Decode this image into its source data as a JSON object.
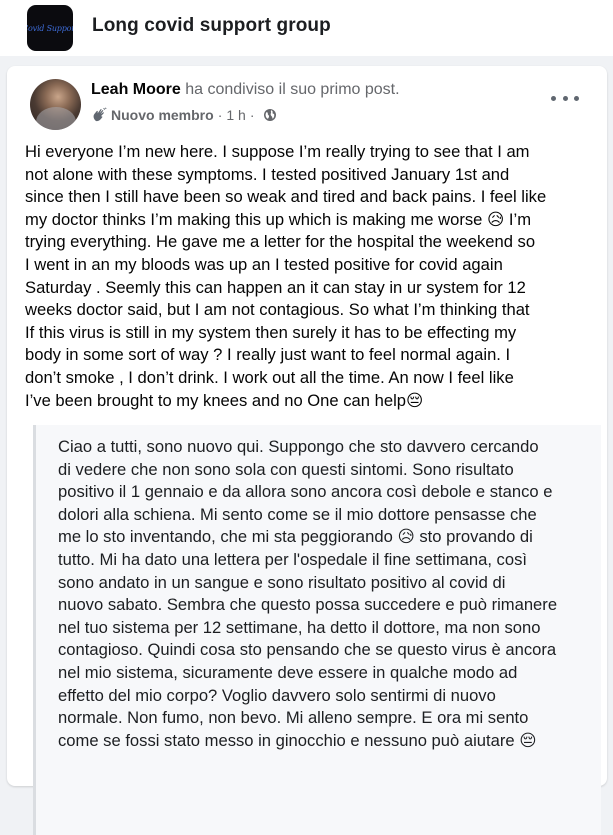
{
  "group": {
    "logo_text": "Covid Support",
    "name": "Long covid support group"
  },
  "post": {
    "author": "Leah Moore",
    "action": " ha condiviso il suo primo post.",
    "badge": "Nuovo membro",
    "separator": "·",
    "time": "1 h",
    "text": "Hi everyone I’m new here. I suppose I’m really trying to see that I am\nnot alone with these symptoms. I tested positived January 1st and\nsince then I still have been so weak and tired and back pains. I feel like\nmy doctor thinks I’m making this up which is making me worse 😥 I’m\ntrying everything. He gave me a letter for the hospital the weekend so\nI went in an my bloods was up an I tested positive for covid again\nSaturday . Seemly this can happen an it can stay in ur system for 12\nweeks doctor said, but I am not contagious. So what I’m thinking that\nIf this virus is still in my system then surely it has to be effecting my\nbody in some sort of way ? I really just want to feel normal again. I\ndon’t smoke , I don’t drink. I work out all the time. An now I feel like\nI’ve been brought to my knees and no One can help😔",
    "translation": "Ciao a tutti, sono nuovo qui. Suppongo che sto davvero cercando\ndi vedere che non sono sola con questi sintomi. Sono risultato\npositivo il 1 gennaio e da allora sono ancora così debole e stanco e\ndolori alla schiena. Mi sento come se il mio dottore pensasse che\nme lo sto inventando, che mi sta peggiorando 😥 sto provando di\ntutto. Mi ha dato una lettera per l'ospedale il fine settimana, così\nsono andato in un sangue e sono risultato positivo al covid di\nnuovo sabato. Sembra che questo possa succedere e può rimanere\nnel tuo sistema per 12 settimane, ha detto il dottore, ma non sono\ncontagioso. Quindi cosa sto pensando che se questo virus è ancora\nnel mio sistema, sicuramente deve essere in qualche modo ad\neffetto del mio corpo? Voglio davvero solo sentirmi di nuovo\nnormale. Non fumo, non bevo. Mi alleno sempre. E ora mi sento\ncome se fossi stato messo in ginocchio e nessuno può aiutare 😔"
  },
  "icons": {
    "new_member": "waving-hand-icon",
    "audience": "globe-icon",
    "menu": "more-options-icon"
  },
  "colors": {
    "name_text": "#050505",
    "secondary_text": "#65676b",
    "card_background": "#ffffff",
    "page_background": "#f0f2f5",
    "quote_border": "#dadde1"
  }
}
